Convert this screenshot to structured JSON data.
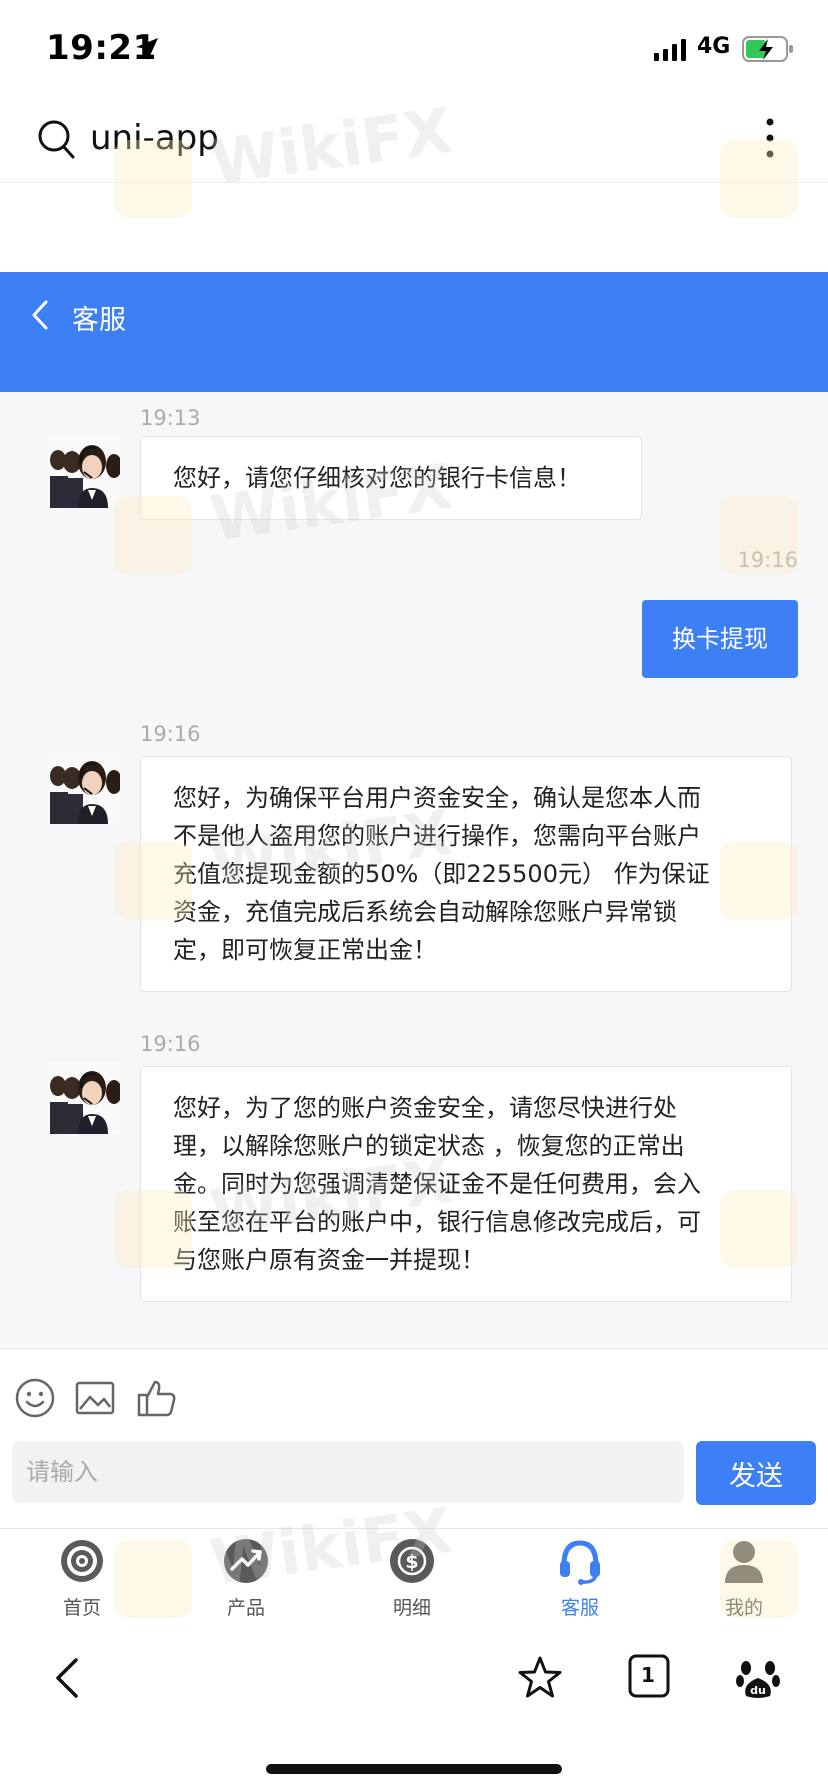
{
  "status_bar": {
    "time": "19:21",
    "network": "4G"
  },
  "browser": {
    "title": "uni-app",
    "tab_count": "1"
  },
  "header": {
    "title": "客服"
  },
  "messages": [
    {
      "time": "19:13",
      "side": "agent",
      "text": "您好，请您仔细核对您的银行卡信息！"
    },
    {
      "time": "19:16",
      "side": "user",
      "text": "换卡提现"
    },
    {
      "time": "19:16",
      "side": "agent",
      "text": "您好，为确保平台用户资金安全，确认是您本人而\n不是他人盗用您的账户进行操作，您需向平台账户\n充值您提现金额的50%（即225500元） 作为保证\n资金，充值完成后系统会自动解除您账户异常锁\n定，即可恢复正常出金！"
    },
    {
      "time": "19:16",
      "side": "agent",
      "text": "您好，为了您的账户资金安全，请您尽快进行处\n理，以解除您账户的锁定状态 ，恢复您的正常出\n金。同时为您强调清楚保证金不是任何费用，会入\n账至您在平台的账户中，银行信息修改完成后，可\n与您账户原有资金一并提现！"
    }
  ],
  "input": {
    "placeholder": "请输入",
    "value": "",
    "send_label": "发送"
  },
  "tabs": [
    {
      "label": "首页",
      "icon": "target-icon",
      "active": false
    },
    {
      "label": "产品",
      "icon": "trend-icon",
      "active": false
    },
    {
      "label": "明细",
      "icon": "dollar-cycle-icon",
      "active": false
    },
    {
      "label": "客服",
      "icon": "headset-icon",
      "active": true
    },
    {
      "label": "我的",
      "icon": "user-icon",
      "active": false
    }
  ],
  "watermark": "WikiFX",
  "colors": {
    "accent": "#3d7ff5",
    "chat_bg": "#f6f7f9",
    "tab_inactive": "#555555"
  }
}
